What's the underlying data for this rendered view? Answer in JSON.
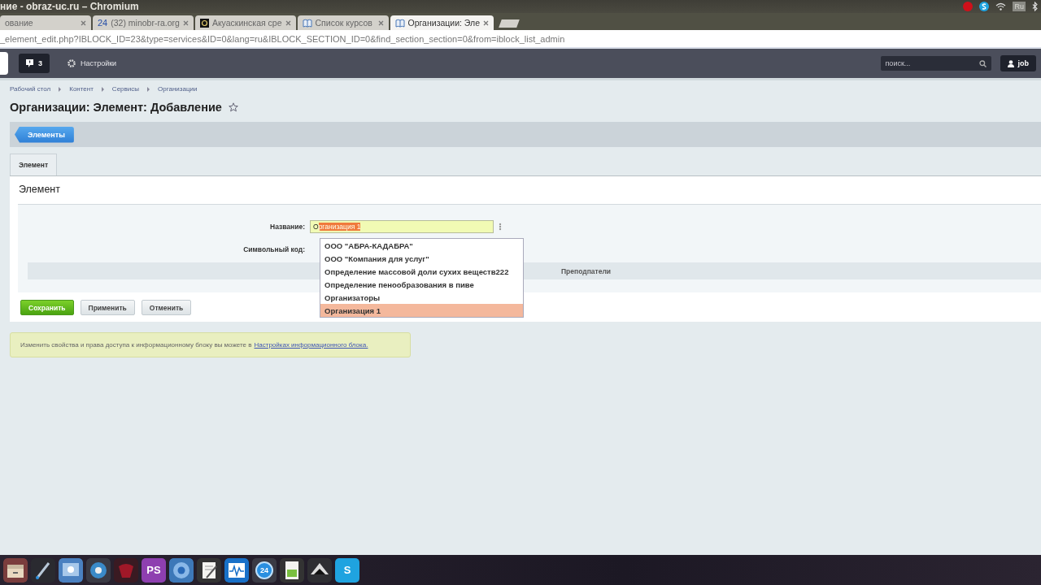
{
  "os_bar": {
    "title": "ние - obraz-uc.ru – Chromium",
    "keyboard_layout": "Ru"
  },
  "browser": {
    "tabs": [
      {
        "title": "ование",
        "kind": "plain",
        "selected": false
      },
      {
        "title": "(32) minobr-ra.org",
        "kind": "counter",
        "favicon_text": "24",
        "selected": false
      },
      {
        "title": "Акуаскинская сре",
        "kind": "dark",
        "selected": false
      },
      {
        "title": "Список курсов",
        "kind": "book",
        "selected": false
      },
      {
        "title": "Организации: Эле",
        "kind": "book",
        "selected": true
      }
    ],
    "url": "_element_edit.php?IBLOCK_ID=23&type=services&ID=0&lang=ru&IBLOCK_SECTION_ID=0&find_section_section=0&from=iblock_list_admin"
  },
  "admin_bar": {
    "notifications": "3",
    "settings": "Настройки",
    "search": {
      "placeholder": "поиск..."
    },
    "user": "job"
  },
  "breadcrumbs": [
    "Рабочий стол",
    "Контент",
    "Сервисы",
    "Организации"
  ],
  "page_title": "Организации: Элемент: Добавление",
  "toolbar": {
    "button": "Элементы"
  },
  "tabs": [
    {
      "label": "Элемент",
      "selected": true
    }
  ],
  "panel": {
    "heading": "Элемент",
    "fields": [
      {
        "label": "Название:",
        "value": "О",
        "selected_text": "рганизация 1"
      },
      {
        "label": "Символьный код:"
      }
    ],
    "section": "Преподпатели",
    "suggestions": [
      {
        "text": "ООО \"АБРА-КАДАБРА\"",
        "selected": false
      },
      {
        "text": "ООО \"Компания для услуг\"",
        "selected": false
      },
      {
        "text": "Определение массовой доли сухих веществ222",
        "selected": false
      },
      {
        "text": "Определение пенообразования в пиве",
        "selected": false
      },
      {
        "text": "Организаторы",
        "selected": false
      },
      {
        "text": "Организация 1",
        "selected": true
      }
    ],
    "buttons": [
      {
        "label": "Сохранить",
        "kind": "primary"
      },
      {
        "label": "Применить",
        "kind": "default"
      },
      {
        "label": "Отменить",
        "kind": "default"
      }
    ]
  },
  "note": {
    "text": "Изменить свойства и права доступа к информационному блоку вы можете в",
    "link": "Настройках информационного блока."
  },
  "dock": [
    {
      "kind": "files"
    },
    {
      "kind": "dropper"
    },
    {
      "kind": "settings"
    },
    {
      "kind": "aperture"
    },
    {
      "kind": "red"
    },
    {
      "kind": "letters",
      "label": "PS",
      "color": "#8e3fb0"
    },
    {
      "kind": "browser"
    },
    {
      "kind": "editor"
    },
    {
      "kind": "monitor"
    },
    {
      "kind": "round",
      "label": "24"
    },
    {
      "kind": "sheet"
    },
    {
      "kind": "inkscape"
    },
    {
      "kind": "letters",
      "label": "S",
      "color": "#1fa3e0"
    }
  ]
}
